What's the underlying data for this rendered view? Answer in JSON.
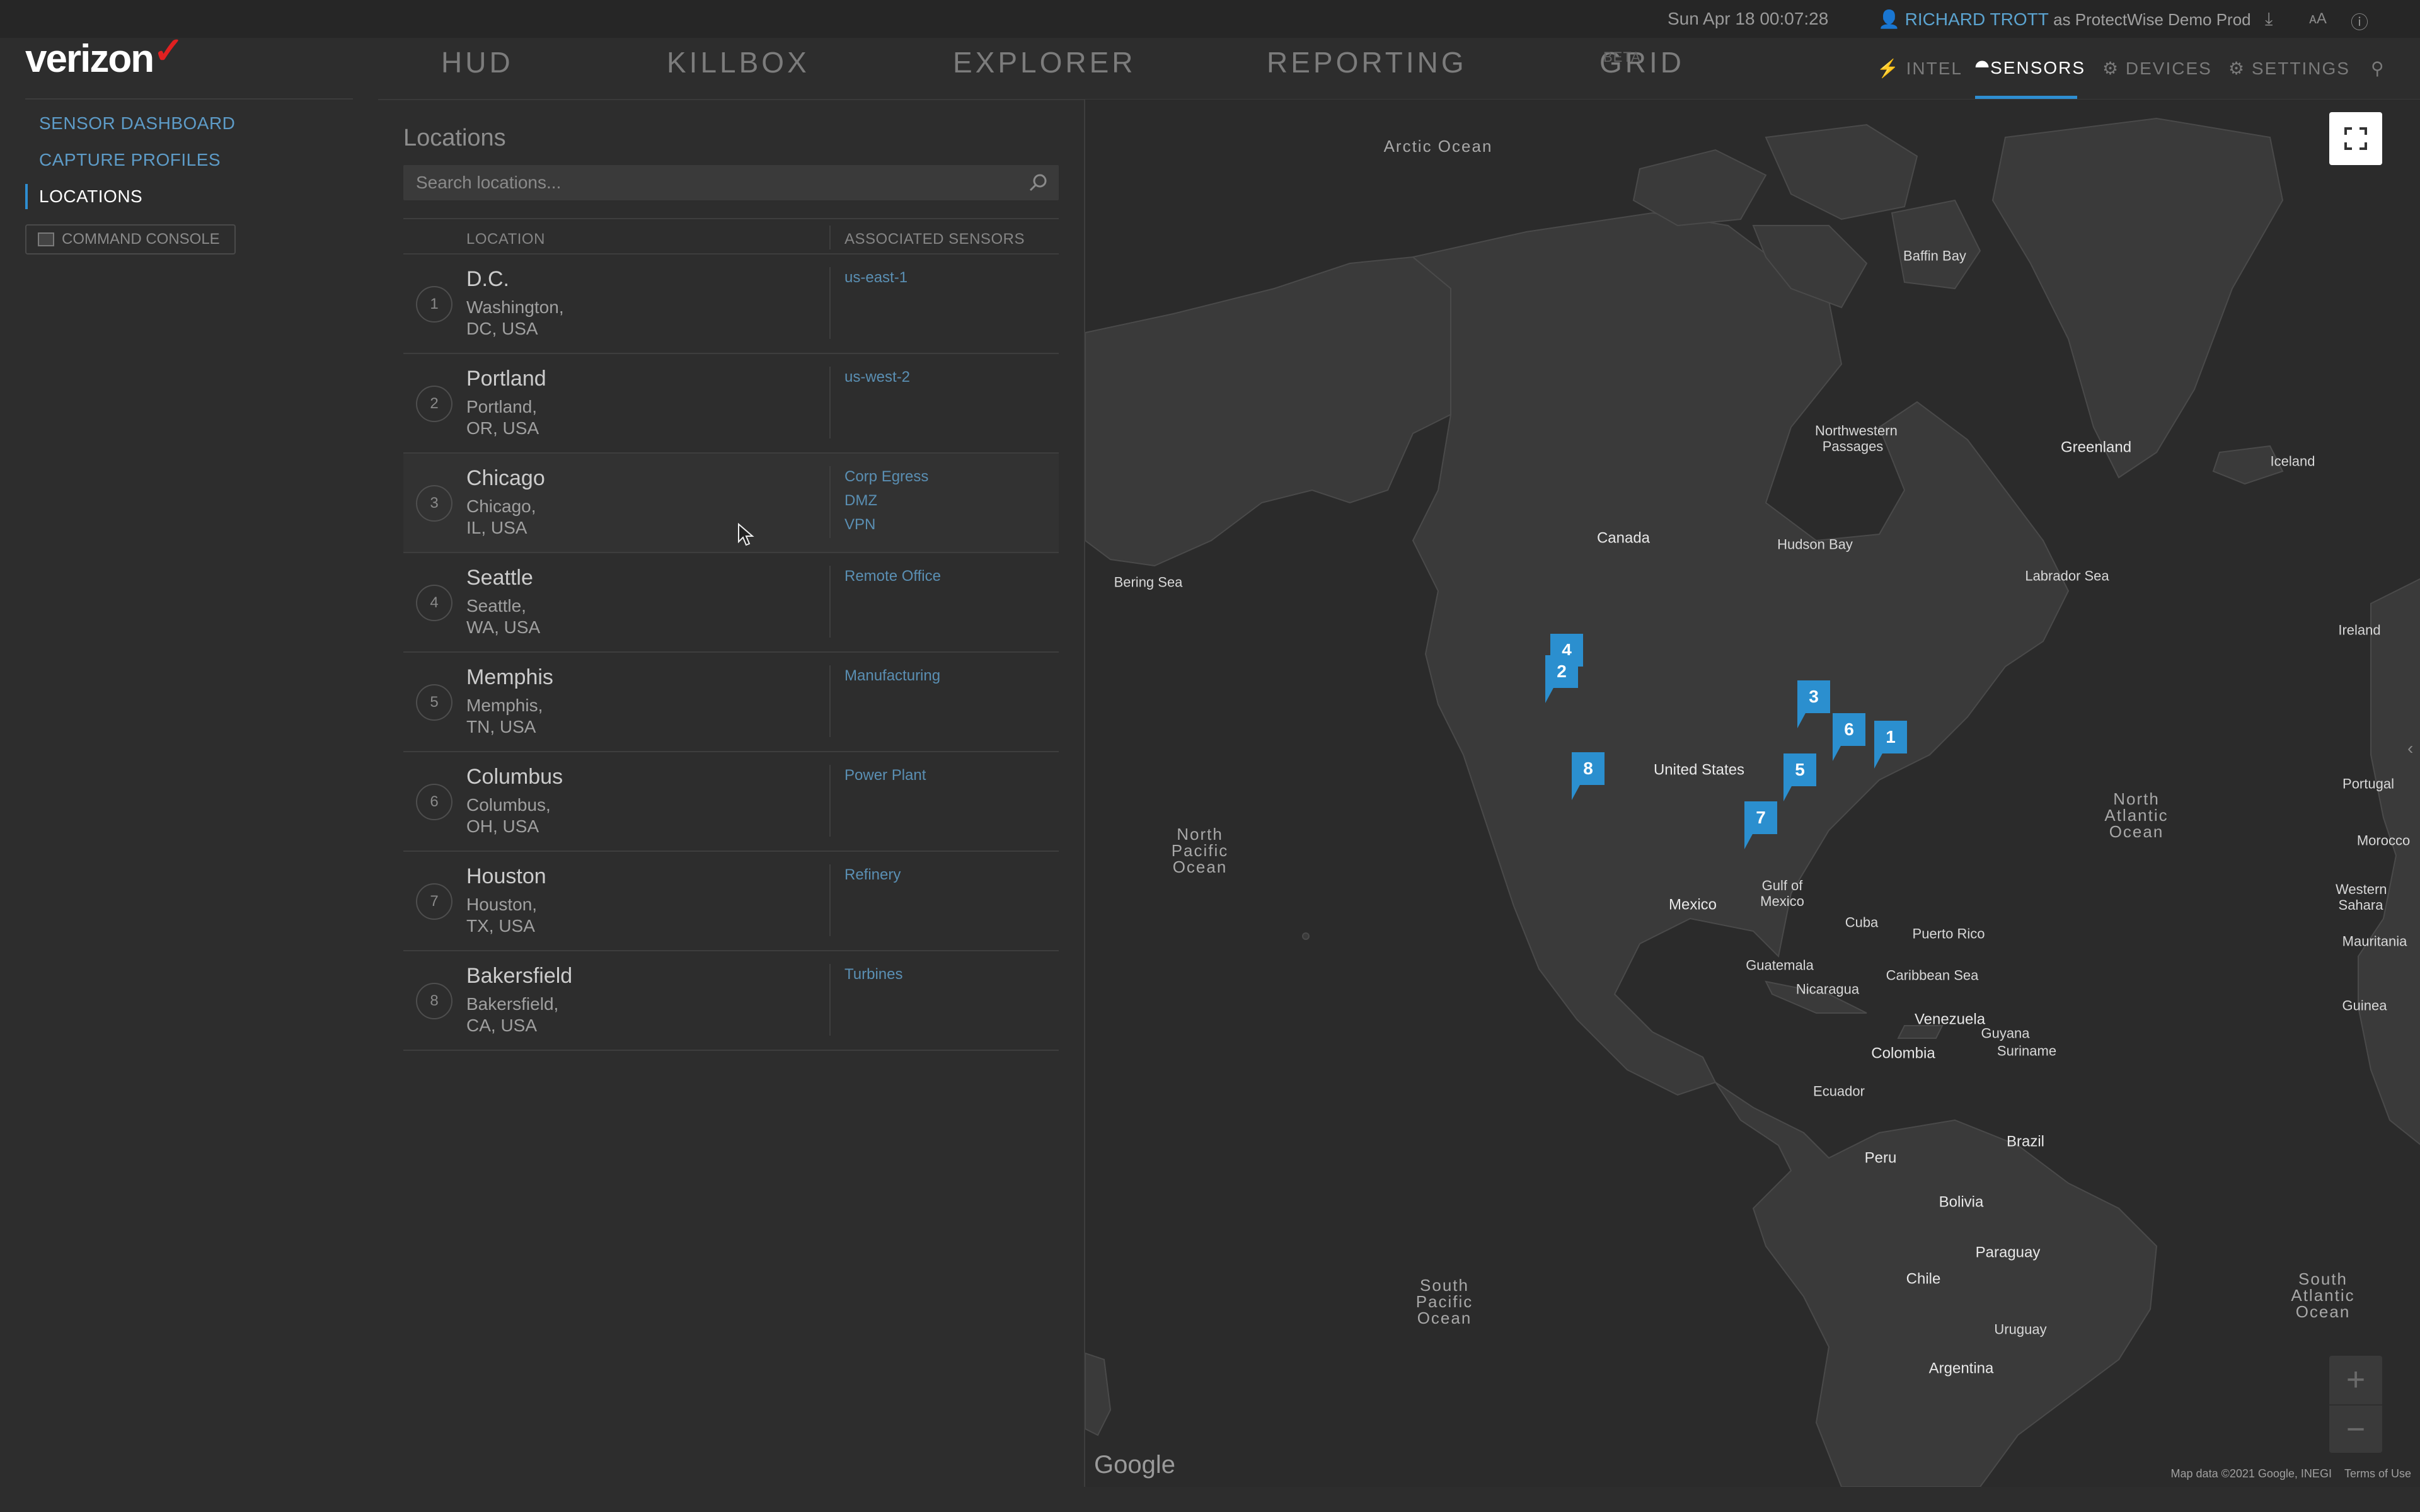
{
  "topbar": {
    "datetime": "Sun Apr 18 00:07:28",
    "user_name": "RICHARD TROTT",
    "user_context": "as ProtectWise Demo Prod"
  },
  "brand": {
    "logo_text": "verizon",
    "logo_mark": "✓"
  },
  "sidebar": {
    "items": [
      {
        "label": "SENSOR DASHBOARD"
      },
      {
        "label": "CAPTURE PROFILES"
      },
      {
        "label": "LOCATIONS"
      }
    ],
    "command_console_label": "COMMAND CONSOLE"
  },
  "main_nav": {
    "items": [
      {
        "label": "HUD"
      },
      {
        "label": "KILLBOX"
      },
      {
        "label": "EXPLORER"
      },
      {
        "label": "REPORTING"
      },
      {
        "label": "GRID",
        "badge": "BETA"
      }
    ]
  },
  "right_nav": {
    "tabs": [
      {
        "label": "INTEL",
        "icon": "intel-icon"
      },
      {
        "label": "SENSORS",
        "icon": "sensor-icon",
        "active": true
      },
      {
        "label": "DEVICES",
        "icon": "devices-icon"
      },
      {
        "label": "SETTINGS",
        "icon": "settings-icon"
      }
    ]
  },
  "locations": {
    "title": "Locations",
    "search_placeholder": "Search locations...",
    "col_location": "LOCATION",
    "col_sensors": "ASSOCIATED SENSORS",
    "rows": [
      {
        "num": "1",
        "name": "D.C.",
        "addr1": "Washington,",
        "addr2": "DC, USA",
        "sensors": [
          "us-east-1"
        ]
      },
      {
        "num": "2",
        "name": "Portland",
        "addr1": "Portland,",
        "addr2": "OR, USA",
        "sensors": [
          "us-west-2"
        ]
      },
      {
        "num": "3",
        "name": "Chicago",
        "addr1": "Chicago,",
        "addr2": "IL, USA",
        "sensors": [
          "Corp Egress",
          "DMZ",
          "VPN"
        ]
      },
      {
        "num": "4",
        "name": "Seattle",
        "addr1": "Seattle,",
        "addr2": "WA, USA",
        "sensors": [
          "Remote Office"
        ]
      },
      {
        "num": "5",
        "name": "Memphis",
        "addr1": "Memphis,",
        "addr2": "TN, USA",
        "sensors": [
          "Manufacturing"
        ]
      },
      {
        "num": "6",
        "name": "Columbus",
        "addr1": "Columbus,",
        "addr2": "OH, USA",
        "sensors": [
          "Power Plant"
        ]
      },
      {
        "num": "7",
        "name": "Houston",
        "addr1": "Houston,",
        "addr2": "TX, USA",
        "sensors": [
          "Refinery"
        ]
      },
      {
        "num": "8",
        "name": "Bakersfield",
        "addr1": "Bakersfield,",
        "addr2": "CA, USA",
        "sensors": [
          "Turbines"
        ]
      }
    ]
  },
  "map": {
    "google_logo": "Google",
    "attribution": "Map data ©2021 Google, INEGI",
    "terms": "Terms of Use",
    "zoom_in": "+",
    "zoom_out": "−",
    "oceans": [
      "Arctic Ocean",
      "North Pacific Ocean",
      "North Atlantic Ocean",
      "South Pacific Ocean",
      "South Atlantic Ocean"
    ],
    "labels": [
      "Baffin Bay",
      "Greenland",
      "Iceland",
      "Northwestern Passages",
      "Hudson Bay",
      "Labrador Sea",
      "Canada",
      "Bering Sea",
      "Ireland",
      "Portugal",
      "United States",
      "Mexico",
      "Gulf of Mexico",
      "Cuba",
      "Puerto Rico",
      "Caribbean Sea",
      "Guatemala",
      "Nicaragua",
      "Venezuela",
      "Colombia",
      "Guyana",
      "Suriname",
      "Ecuador",
      "Peru",
      "Brazil",
      "Bolivia",
      "Paraguay",
      "Chile",
      "Uruguay",
      "Argentina",
      "Mauritania",
      "Western Sahara",
      "Guinea",
      "Morocco"
    ]
  }
}
